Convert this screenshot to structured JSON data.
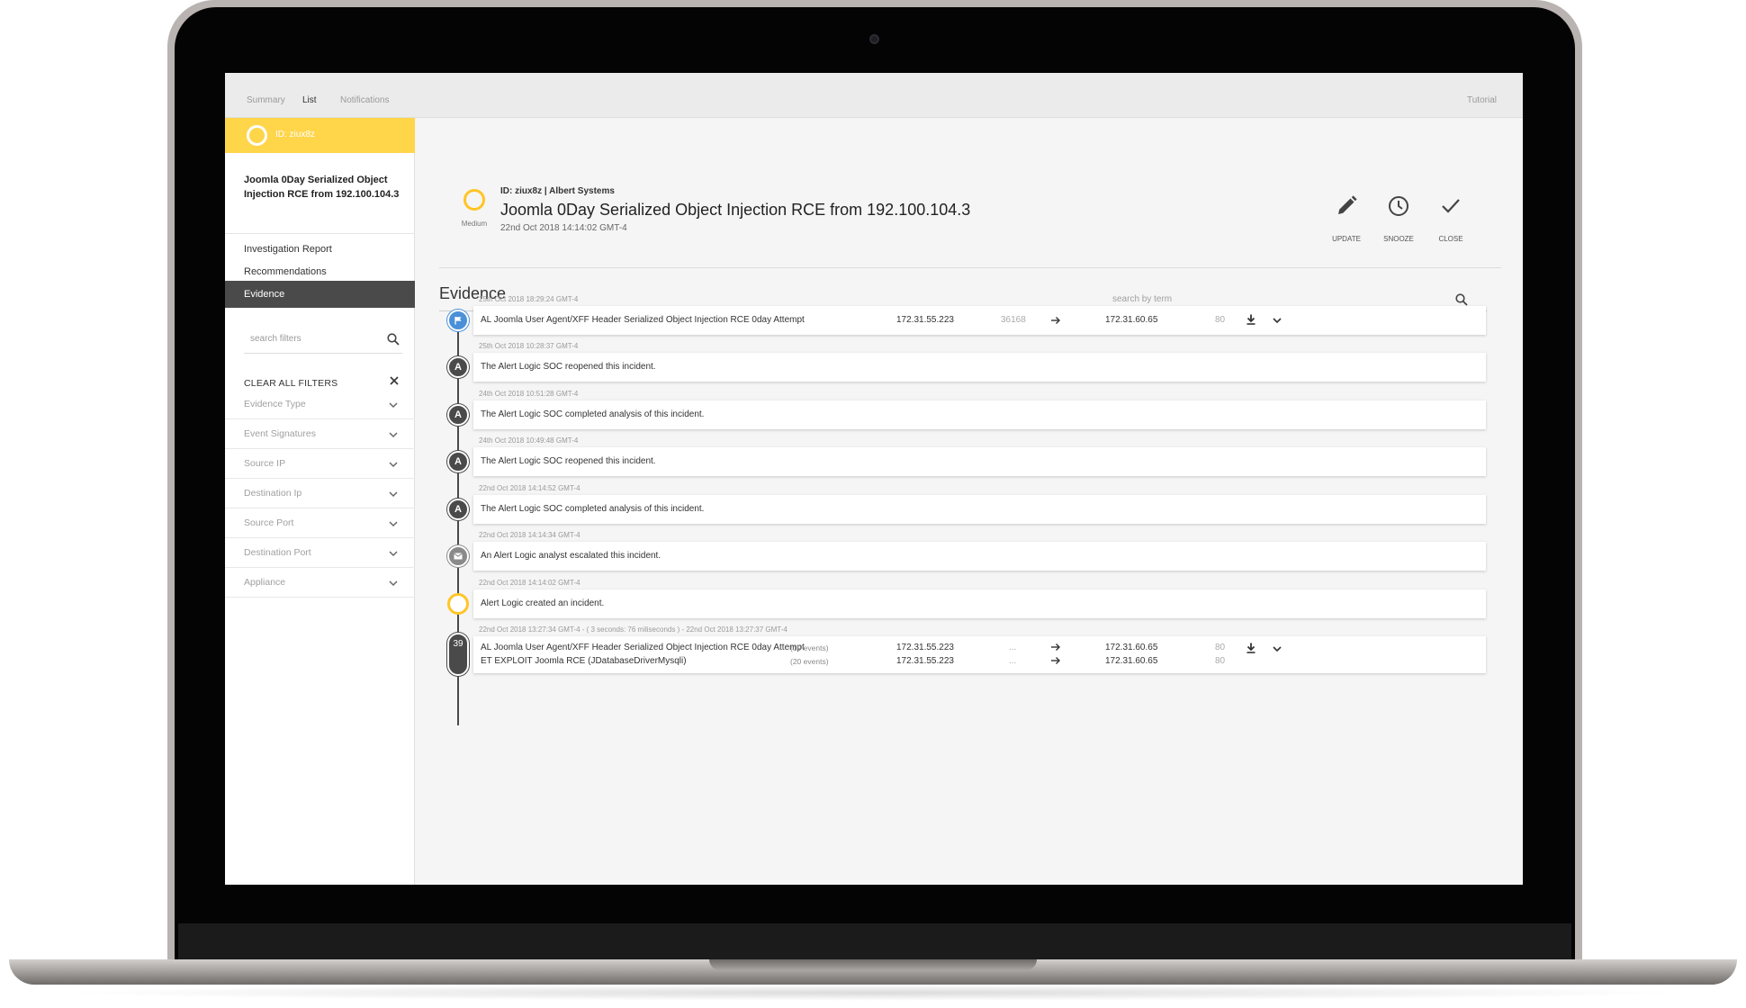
{
  "tabs": {
    "summary": "Summary",
    "list": "List",
    "notifications": "Notifications",
    "tutorial": "Tutorial"
  },
  "sidebar": {
    "id_label": "ID: ziux8z",
    "incident_title": "Joomla 0Day Serialized Object Injection RCE from 192.100.104.3",
    "nav": [
      "Investigation Report",
      "Recommendations",
      "Evidence"
    ],
    "search_placeholder": "search filters",
    "clear_filters": "CLEAR ALL FILTERS",
    "filters": [
      "Evidence Type",
      "Event Signatures",
      "Source IP",
      "Destination Ip",
      "Source Port",
      "Destination Port",
      "Appliance"
    ]
  },
  "header": {
    "severity": "Medium",
    "id_line": "ID: ziux8z | Albert Systems",
    "title": "Joomla 0Day Serialized Object Injection RCE from 192.100.104.3",
    "date": "22nd Oct 2018 14:14:02 GMT-4",
    "actions": [
      "UPDATE",
      "SNOOZE",
      "CLOSE"
    ]
  },
  "evidence": {
    "title": "Evidence",
    "search_placeholder": "search by term",
    "events": [
      {
        "timestamp": "25th Oct 2018 18:29:24 GMT-4",
        "icon": "flag-icon",
        "text": "AL Joomla User Agent/XFF Header Serialized Object Injection RCE 0day Attempt",
        "src_ip": "172.31.55.223",
        "src_port": "36168",
        "dst_ip": "172.31.60.65",
        "dst_port": "80"
      },
      {
        "timestamp": "25th Oct 2018 10:28:37 GMT-4",
        "icon": "alert-logic-icon",
        "text": "The Alert Logic SOC reopened this incident."
      },
      {
        "timestamp": "24th Oct 2018 10:51:28 GMT-4",
        "icon": "alert-logic-icon",
        "text": "The Alert Logic SOC completed analysis of this incident."
      },
      {
        "timestamp": "24th Oct 2018 10:49:48 GMT-4",
        "icon": "alert-logic-icon",
        "text": "The Alert Logic SOC reopened this incident."
      },
      {
        "timestamp": "22nd Oct 2018 14:14:52 GMT-4",
        "icon": "alert-logic-icon",
        "text": "The Alert Logic SOC completed analysis of this incident."
      },
      {
        "timestamp": "22nd Oct 2018 14:14:34 GMT-4",
        "icon": "mail-icon",
        "text": "An Alert Logic analyst escalated this incident."
      },
      {
        "timestamp": "22nd Oct 2018 14:14:02 GMT-4",
        "icon": "ring-icon",
        "text": "Alert Logic created an incident."
      }
    ],
    "group": {
      "timestamp": "22nd Oct 2018 13:27:34 GMT-4 - ( 3 seconds: 76 miliseconds ) - 22nd Oct 2018 13:27:37 GMT-4",
      "count": "39",
      "rows": [
        {
          "text": "AL Joomla User Agent/XFF Header Serialized Object Injection RCE 0day Attempt",
          "events": "(19 events)",
          "src_ip": "172.31.55.223",
          "src_port": "...",
          "dst_ip": "172.31.60.65",
          "dst_port": "80"
        },
        {
          "text": "ET EXPLOIT Joomla RCE (JDatabaseDriverMysqli)",
          "events": "(20 events)",
          "src_ip": "172.31.55.223",
          "src_port": "...",
          "dst_ip": "172.31.60.65",
          "dst_port": "80"
        }
      ]
    }
  }
}
